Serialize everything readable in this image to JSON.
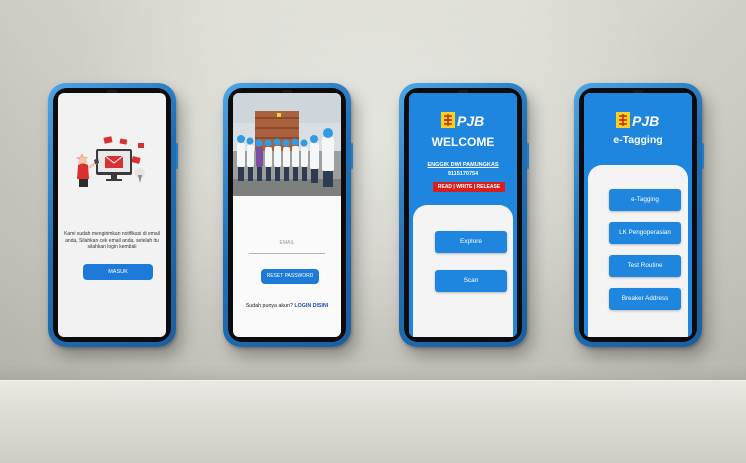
{
  "screen1": {
    "notification_text": "Kami sudah mengirimkan notifikasi di email anda, Silahkan cek email anda, setelah itu silahkan login kembali",
    "masuk_label": "MASUK"
  },
  "screen2": {
    "email_placeholder": "EMAIL",
    "reset_label": "RESET PASSWORD",
    "account_question": "Sudah punya akun?",
    "login_link": "LOGIN DISINI"
  },
  "screen3": {
    "logo_text": "PJB",
    "welcome": "WELCOME",
    "user_name": "ENGGIK DWI PAMUNGKAS",
    "user_id": "9115170754",
    "mode_banner": "READ | WRITE | RELEASE",
    "explore_label": "Explore",
    "scan_label": "Scan"
  },
  "screen4": {
    "logo_text": "PJB",
    "title": "e-Tagging",
    "menu": [
      "e-Tagging",
      "LK Pengoperasian",
      "Test Routine",
      "Breaker Address"
    ]
  },
  "colors": {
    "primary_blue": "#1e86df",
    "button_blue": "#1e7ad9",
    "banner_red": "#d81f1f",
    "phone_frame": "#1f6fb6"
  }
}
